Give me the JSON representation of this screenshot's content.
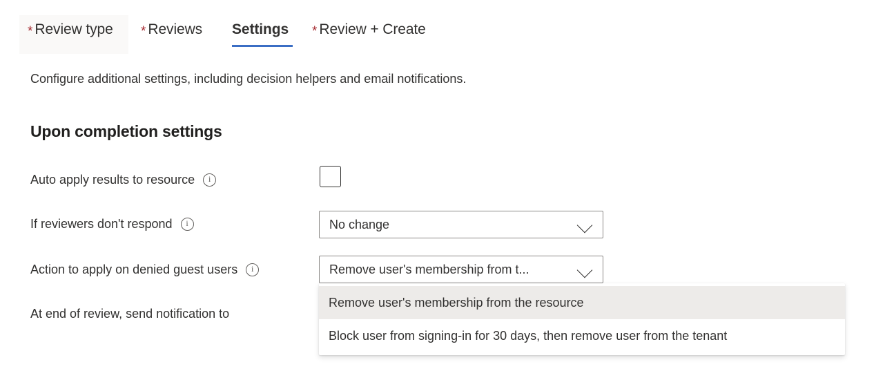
{
  "tabs": [
    {
      "label": "Review type",
      "required": true,
      "active": false,
      "hovered": true
    },
    {
      "label": "Reviews",
      "required": true,
      "active": false,
      "hovered": false
    },
    {
      "label": "Settings",
      "required": false,
      "active": true,
      "hovered": false
    },
    {
      "label": "Review + Create",
      "required": true,
      "active": false,
      "hovered": false
    }
  ],
  "page": {
    "description": "Configure additional settings, including decision helpers and email notifications.",
    "section_title": "Upon completion settings"
  },
  "fields": {
    "auto_apply": {
      "label": "Auto apply results to resource",
      "info_icon": "info-circle-icon",
      "checkbox_checked": false
    },
    "no_respond": {
      "label": "If reviewers don't respond",
      "info_icon": "info-circle-icon",
      "value": "No change",
      "chevron_icon": "chevron-down-icon"
    },
    "denied_guest": {
      "label": "Action to apply on denied guest users",
      "info_icon": "info-circle-icon",
      "value": "Remove user's membership from t...",
      "chevron_icon": "chevron-down-icon",
      "expanded": true,
      "options": [
        {
          "label": "Remove user's membership from the resource",
          "selected": true
        },
        {
          "label": "Block user from signing-in for 30 days, then remove user from the tenant",
          "selected": false
        }
      ]
    },
    "notify": {
      "label": "At end of review, send notification to"
    }
  },
  "colors": {
    "accent": "#3b6ec4",
    "required_asterisk": "#a4262c",
    "text": "#323130",
    "option_selected_bg": "#edebe9",
    "tab_hover_bg": "#faf9f8"
  }
}
